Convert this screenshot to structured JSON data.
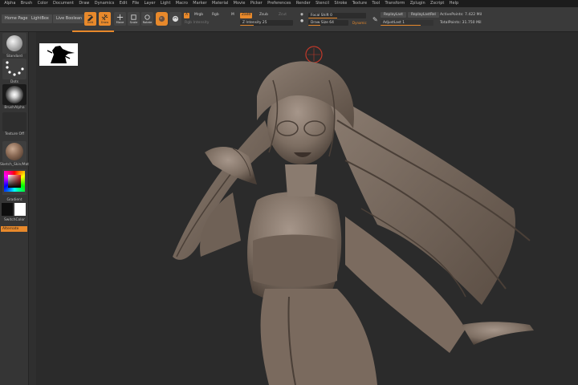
{
  "menu": [
    "Alpha",
    "Brush",
    "Color",
    "Document",
    "Draw",
    "Dynamics",
    "Edit",
    "File",
    "Layer",
    "Light",
    "Macro",
    "Marker",
    "Material",
    "Movie",
    "Picker",
    "Preferences",
    "Render",
    "Stencil",
    "Stroke",
    "Texture",
    "Tool",
    "Transform",
    "Zplugin",
    "Zscript",
    "Help"
  ],
  "shelf": {
    "home_page": "Home Page",
    "lightbox": "LightBox",
    "live_boolean": "Live Boolean",
    "edit": "Edit",
    "draw": "Draw",
    "move": "Move",
    "scale": "Scale",
    "rotate": "Rotate",
    "a_label": "A",
    "mrgb": "Mrgb",
    "rgb": "Rgb",
    "m": "M",
    "zadd": "Zadd",
    "zsub": "Zsub",
    "zcut": "Zcut",
    "rgb_intensity": "Rgb Intensity",
    "z_intensity": "Z Intensity 25",
    "focal_shift": "Focal Shift 0",
    "draw_size": "Draw Size 64",
    "dynamic": "Dynamic",
    "replay_last": "ReplayLast",
    "replay_last_rel": "ReplayLastRel",
    "adjust_last": "AdjustLast 1",
    "active_points": "ActivePoints: 7.422 Mil",
    "total_points": "TotalPoints: 31.750 Mil"
  },
  "tray": {
    "standard": "Standard",
    "dots": "Dots",
    "brush_alpha": "BrushAlpha",
    "texture_off": "Texture Off",
    "material": "Sketch_Skin/Mat",
    "gradient": "Gradient",
    "switch_color": "SwitchColor",
    "alternate": "Alternate"
  },
  "colors": {
    "accent": "#e8892b",
    "sculpt": "#8a7a6c",
    "bg": "#2b2b2b"
  }
}
